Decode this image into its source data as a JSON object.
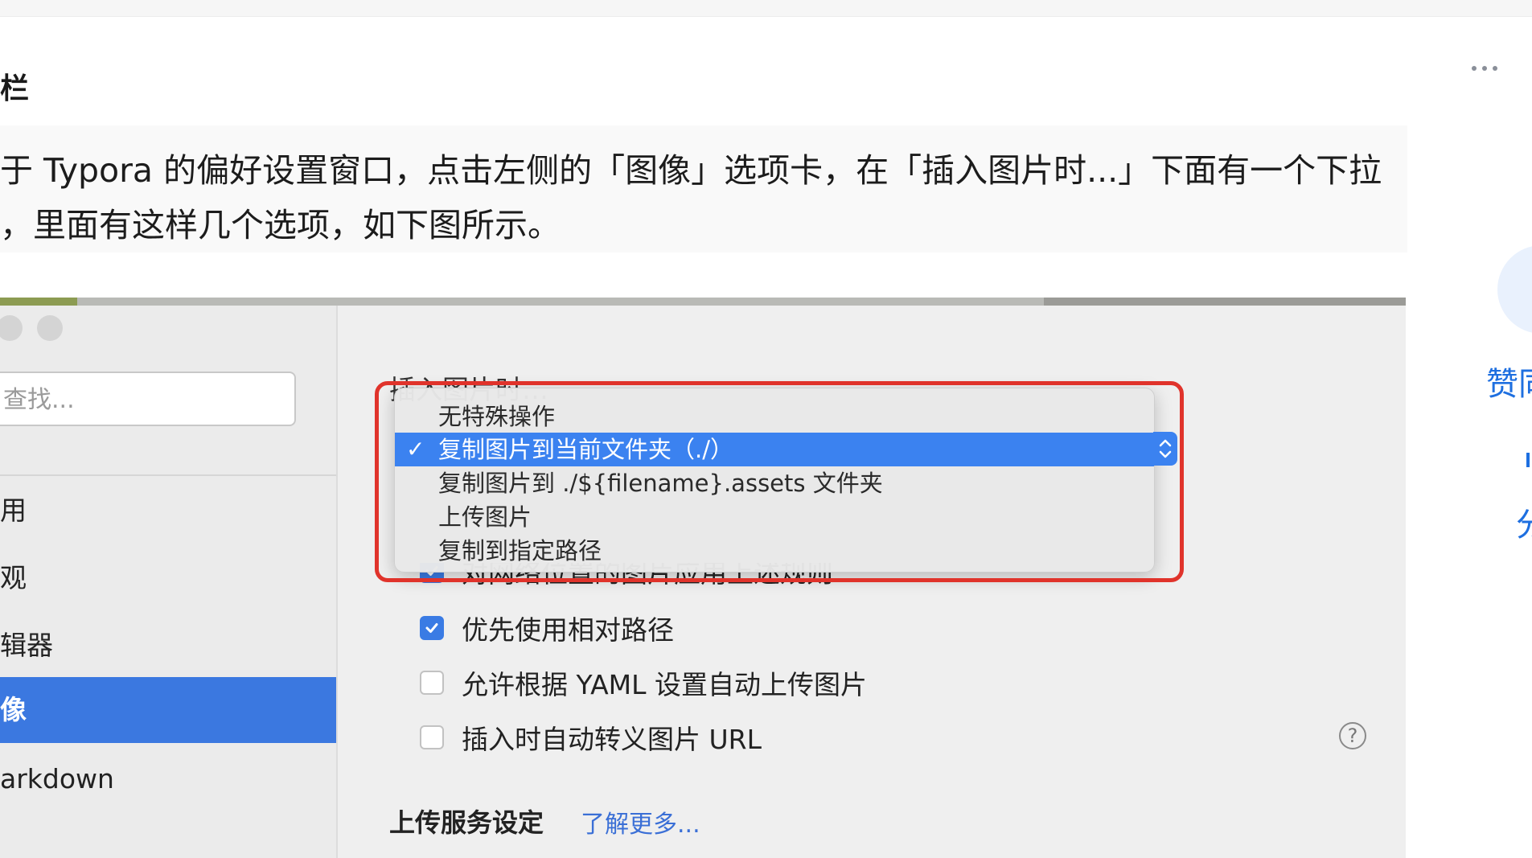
{
  "header": {
    "section_title": "栏",
    "more_label": "..."
  },
  "article": {
    "paragraph_line1": "于 Typora 的偏好设置窗口，点击左侧的「图像」选项卡，在「插入图片时...」下面有一个下拉",
    "paragraph_line2": "，里面有这样几个选项，如下图所示。"
  },
  "side_actions": {
    "agree": "赞同",
    "share": "分"
  },
  "screenshot": {
    "header_file": "header.jpg",
    "sidebar": {
      "search_placeholder": "查找...",
      "items": [
        {
          "label": "用",
          "active": false
        },
        {
          "label": "观",
          "active": false
        },
        {
          "label": "辑器",
          "active": false
        },
        {
          "label": "像",
          "active": true
        },
        {
          "label": "arkdown",
          "active": false
        }
      ]
    },
    "insert_label": "插入图片时…",
    "dropdown": {
      "options": [
        {
          "label": "无特殊操作",
          "selected": false
        },
        {
          "label": "复制图片到当前文件夹（./）",
          "selected": true
        },
        {
          "label": "复制图片到 ./${filename}.assets 文件夹",
          "selected": false
        },
        {
          "label": "上传图片",
          "selected": false
        },
        {
          "label": "复制到指定路径",
          "selected": false
        }
      ],
      "check_mark": "✓"
    },
    "checkboxes": [
      {
        "label": "对网络位置的图片应用上述规则",
        "checked": true
      },
      {
        "label": "优先使用相对路径",
        "checked": true
      },
      {
        "label": "允许根据 YAML 设置自动上传图片",
        "checked": false
      },
      {
        "label": "插入时自动转义图片 URL",
        "checked": false
      }
    ],
    "help_icon": "?",
    "upload_section_title": "上传服务设定",
    "learn_more": "了解更多..."
  },
  "colors": {
    "accent_blue": "#3b82f0",
    "sidebar_active": "#3b78e0",
    "highlight_red": "#e0332b",
    "link_blue": "#1e6fe0"
  }
}
